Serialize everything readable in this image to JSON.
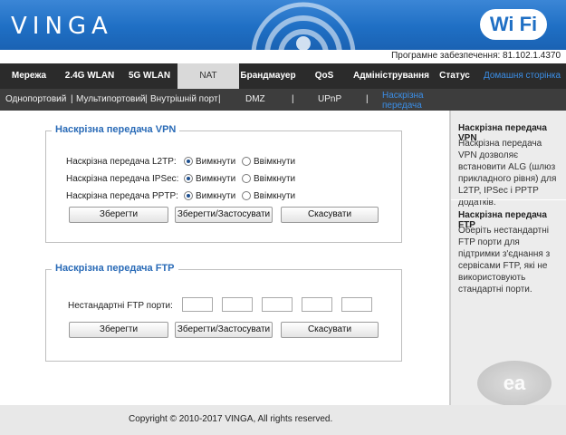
{
  "header": {
    "logo": "VINGA",
    "wifi_badge": "Wi Fi",
    "firmware": "Програмне забезпечення: 81.102.1.4370"
  },
  "nav": [
    {
      "label": "Мережа"
    },
    {
      "label": "2.4G WLAN"
    },
    {
      "label": "5G WLAN"
    },
    {
      "label": "NAT"
    },
    {
      "label": "Брандмауер"
    },
    {
      "label": "QoS"
    },
    {
      "label": "Адміністрування"
    },
    {
      "label": "Статус"
    },
    {
      "label": "Домашня сторінка"
    }
  ],
  "subnav": [
    {
      "label": "Однопортовий"
    },
    {
      "label": "Мультипортовий"
    },
    {
      "label": "Внутрішній порт"
    },
    {
      "label": "DMZ"
    },
    {
      "label": "UPnP"
    },
    {
      "label": "Наскрізна передача"
    }
  ],
  "vpn": {
    "title": "Наскрізна передача VPN",
    "rows": [
      {
        "label": "Наскрізна передача L2TP:",
        "off": "Вимкнути",
        "on": "Ввімкнути",
        "selected": "off"
      },
      {
        "label": "Наскрізна передача IPSec:",
        "off": "Вимкнути",
        "on": "Ввімкнути",
        "selected": "off"
      },
      {
        "label": "Наскрізна передача PPTP:",
        "off": "Вимкнути",
        "on": "Ввімкнути",
        "selected": "off"
      }
    ],
    "save": "Зберегти",
    "save_apply": "Зберегти/Застосувати",
    "cancel": "Скасувати"
  },
  "ftp": {
    "title": "Наскрізна передача FTP",
    "ports_label": "Нестандартні FTP порти:",
    "ports": [
      "",
      "",
      "",
      "",
      ""
    ],
    "save": "Зберегти",
    "save_apply": "Зберегти/Застосувати",
    "cancel": "Скасувати"
  },
  "sidebar": {
    "vpn_title": "Наскрізна передача VPN",
    "vpn_text": "Наскрізна передача VPN дозволяє встановити ALG (шлюз прикладного рівня) для L2TP, IPSec і PPTP додатків.",
    "ftp_title": "Наскрізна передача FTP",
    "ftp_text": "Оберіть нестандартні FTP порти для підтримки з'єднання з сервісами FTP, які не використовують стандартні порти."
  },
  "footer": {
    "copyright": "Copyright © 2010-2017 VINGA, All rights reserved."
  },
  "colors": {
    "header_blue": "#1f6fc4",
    "nav_dark": "#2b2b2b",
    "link_blue": "#3b8ee6",
    "title_blue": "#2a6bb7"
  }
}
